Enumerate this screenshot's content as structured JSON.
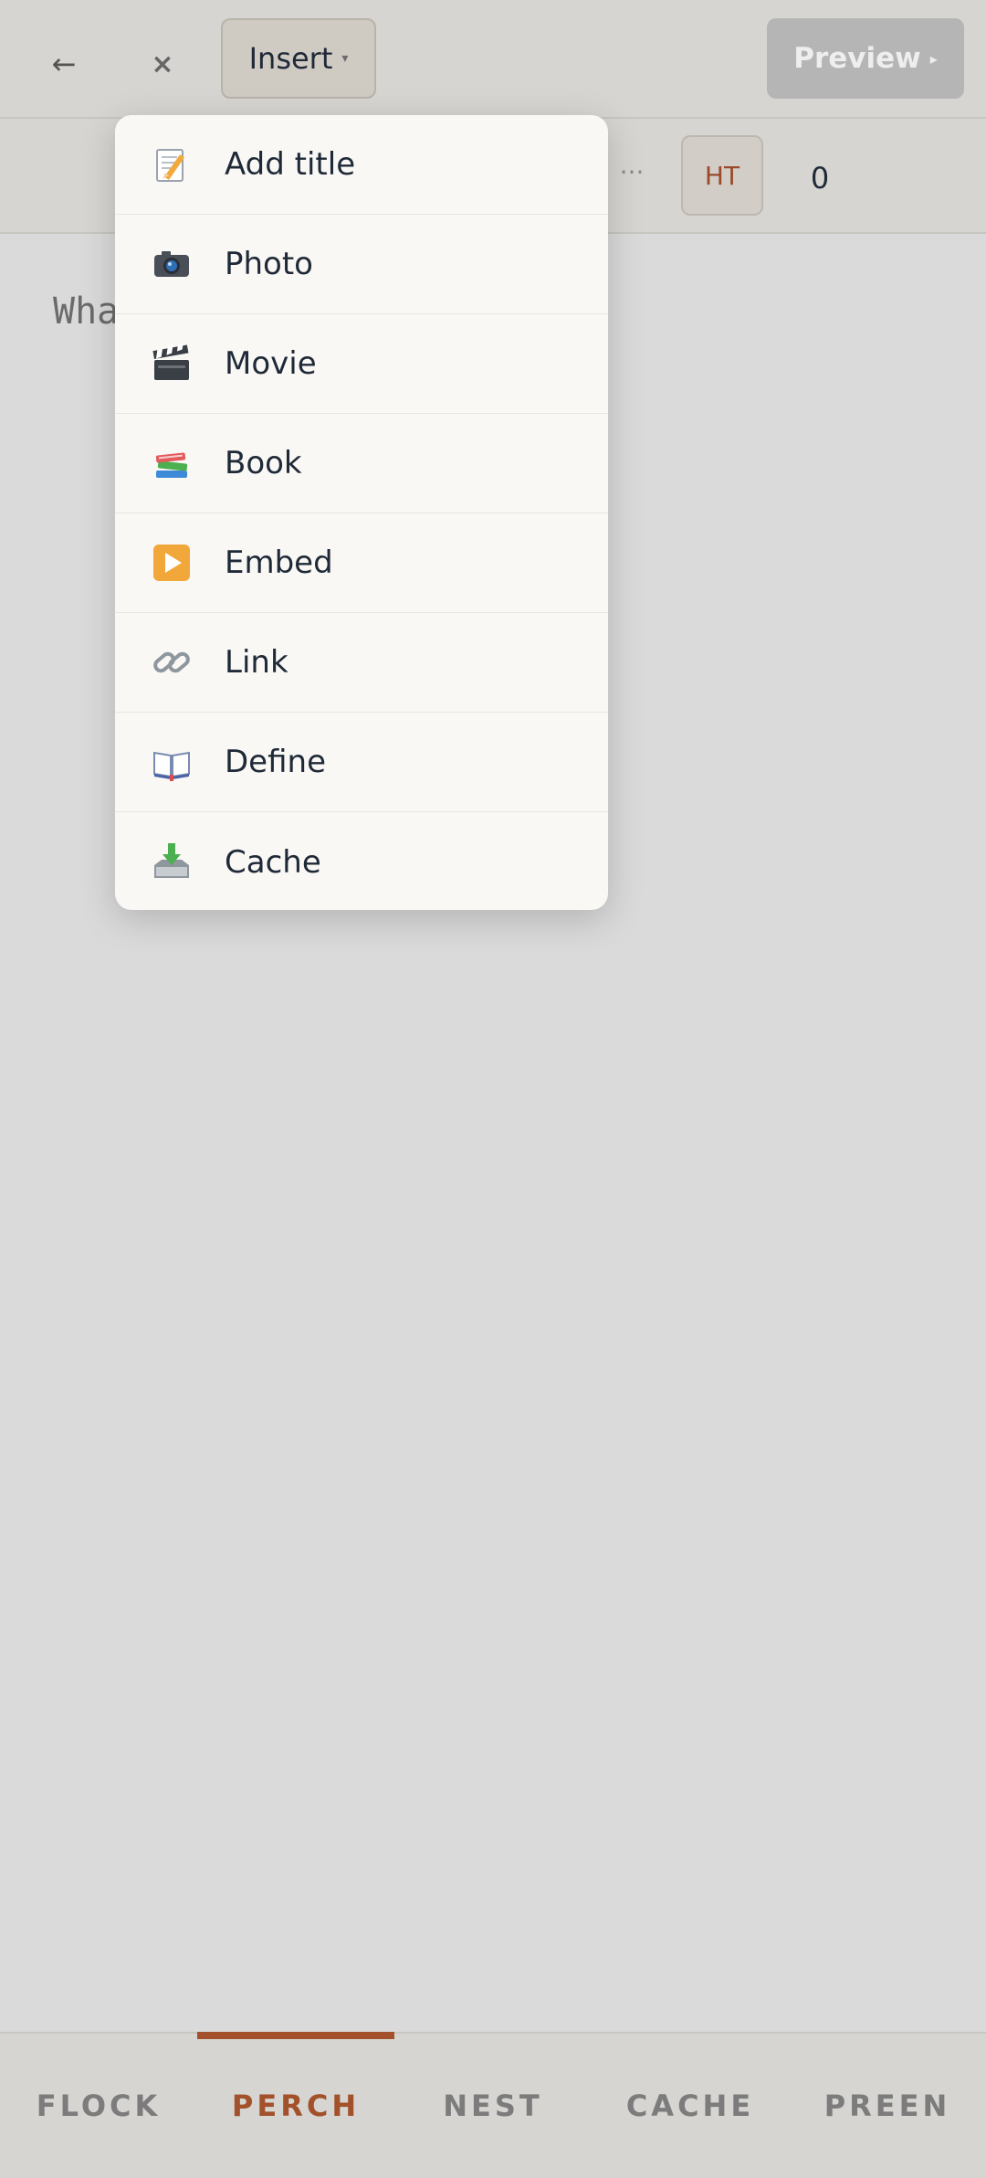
{
  "topbar": {
    "back_icon": "←",
    "close_icon": "×",
    "insert_label": "Insert",
    "insert_caret": "▾",
    "preview_label": "Preview",
    "preview_caret": "▸"
  },
  "toolbar": {
    "more_icon": "···",
    "badge_label": "HT",
    "count": "0"
  },
  "editor": {
    "placeholder_visible": "Wha"
  },
  "insert_menu": {
    "items": [
      {
        "label": "Add title",
        "icon": "memo-icon"
      },
      {
        "label": "Photo",
        "icon": "camera-icon"
      },
      {
        "label": "Movie",
        "icon": "clapper-icon"
      },
      {
        "label": "Book",
        "icon": "books-icon"
      },
      {
        "label": "Embed",
        "icon": "play-icon"
      },
      {
        "label": "Link",
        "icon": "link-icon"
      },
      {
        "label": "Define",
        "icon": "open-book-icon"
      },
      {
        "label": "Cache",
        "icon": "inbox-icon"
      }
    ]
  },
  "bottom_nav": {
    "items": [
      {
        "label": "FLOCK"
      },
      {
        "label": "PERCH"
      },
      {
        "label": "NEST"
      },
      {
        "label": "CACHE"
      },
      {
        "label": "PREEN"
      }
    ],
    "active_index": 1
  },
  "colors": {
    "accent": "#a2512a",
    "background": "#dadada",
    "menu_bg": "#f9f8f5"
  }
}
